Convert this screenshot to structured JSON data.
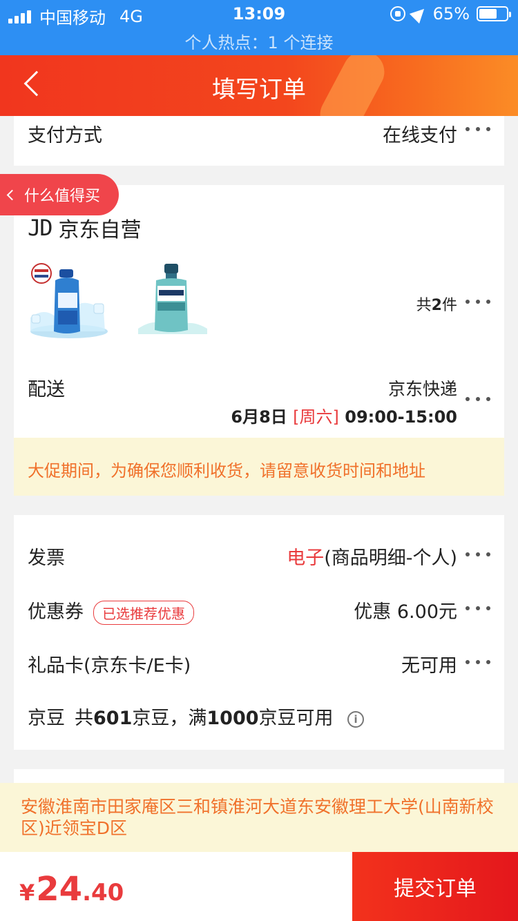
{
  "status_bar": {
    "carrier": "中国移动",
    "network": "4G",
    "time": "13:09",
    "battery": "65%",
    "battery_level": 0.65,
    "hotspot": "个人热点：1 个连接"
  },
  "navbar": {
    "title": "填写订单",
    "back_icon": "chevron-left-icon"
  },
  "payment": {
    "label": "支付方式",
    "value": "在线支付"
  },
  "floating_tag": {
    "label": "什么值得买"
  },
  "shop": {
    "logo_text": "JD",
    "name": "京东自营",
    "count_prefix": "共",
    "count": "2",
    "count_suffix": "件"
  },
  "delivery": {
    "label": "配送",
    "method": "京东快递",
    "date": "6月8日",
    "weekday": "[周六]",
    "time_range": "09:00-15:00"
  },
  "notice": "大促期间，为确保您顺利收货，请留意收货时间和地址",
  "invoice": {
    "label": "发票",
    "type_highlight": "电子",
    "detail": "(商品明细-个人)"
  },
  "coupon": {
    "label": "优惠券",
    "badge": "已选推荐优惠",
    "value": "优惠 6.00元"
  },
  "gift_card": {
    "label": "礼品卡(京东卡/E卡)",
    "value": "无可用"
  },
  "jingdou": {
    "label": "京豆",
    "text_1": "共",
    "total": "601",
    "text_2": "京豆，满",
    "threshold": "1000",
    "text_3": "京豆可用"
  },
  "address": "安徽淮南市田家庵区三和镇淮河大道东安徽理工大学(山南新校区)近领宝D区",
  "footer": {
    "currency": "¥",
    "price_integer": "24",
    "price_decimal": ".40",
    "submit_label": "提交订单"
  },
  "colors": {
    "accent_red": "#e93b3d",
    "nav_orange": "#f3461d",
    "notice_text": "#f0712b",
    "notice_bg": "#fbf6d7",
    "status_blue": "#2d8ff3"
  }
}
